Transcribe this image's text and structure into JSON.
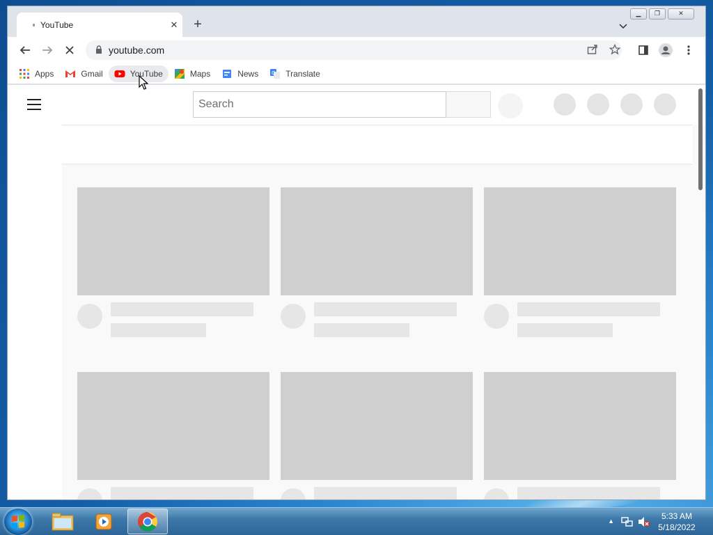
{
  "browser": {
    "tab_title": "YouTube",
    "tab_close": "✕",
    "new_tab": "+",
    "url": "youtube.com"
  },
  "bookmarks": [
    {
      "label": "Apps",
      "icon": "apps-grid-icon"
    },
    {
      "label": "Gmail",
      "icon": "gmail-icon"
    },
    {
      "label": "YouTube",
      "icon": "youtube-icon"
    },
    {
      "label": "Maps",
      "icon": "maps-icon"
    },
    {
      "label": "News",
      "icon": "news-icon"
    },
    {
      "label": "Translate",
      "icon": "translate-icon"
    }
  ],
  "youtube": {
    "search_placeholder": "Search"
  },
  "taskbar": {
    "time": "5:33 AM",
    "date": "5/18/2022"
  },
  "colors": {
    "youtube_red": "#ff0000",
    "skeleton_thumb": "#cfcfcf",
    "skeleton_line": "#e6e6e6"
  }
}
